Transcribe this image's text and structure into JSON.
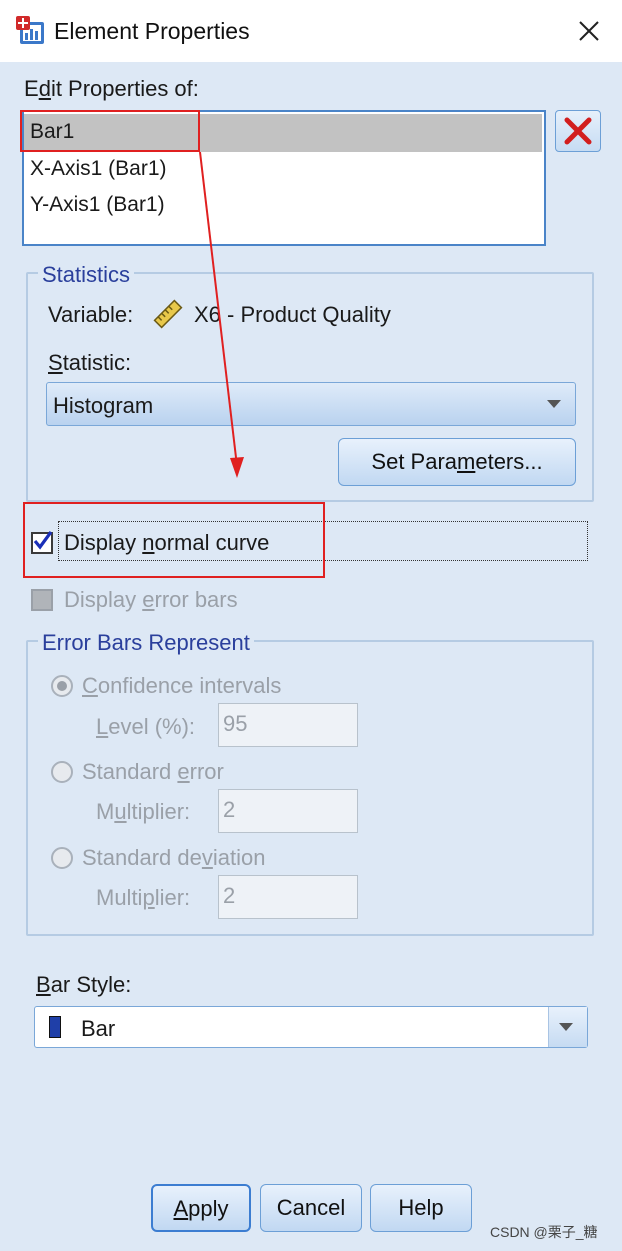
{
  "window": {
    "title": "Element Properties"
  },
  "edit_properties": {
    "label_pre": "E",
    "label_accel": "d",
    "label_post": "it Properties of:",
    "items": [
      "Bar1",
      "X-Axis1 (Bar1)",
      "Y-Axis1 (Bar1)"
    ],
    "selected": "Bar1"
  },
  "statistics": {
    "title": "Statistics",
    "variable_label": "Variable:",
    "variable_value": "X6 - Product Quality",
    "statistic_label_accel": "S",
    "statistic_label_rest": "tatistic:",
    "statistic_value": "Histogram",
    "set_parameters_pre": "Set Para",
    "set_parameters_accel": "m",
    "set_parameters_post": "eters..."
  },
  "display_normal_curve": {
    "pre": "Display ",
    "accel": "n",
    "post": "ormal curve",
    "checked": true
  },
  "display_error_bars": {
    "pre": "Display ",
    "accel": "e",
    "post": "rror bars",
    "checked": false
  },
  "error_bars": {
    "title": "Error Bars Represent",
    "confidence": {
      "accel": "C",
      "rest": "onfidence intervals",
      "selected": true,
      "field_pre": "",
      "field_accel": "L",
      "field_post": "evel (%):",
      "value": "95"
    },
    "std_error": {
      "pre": "Standard ",
      "accel": "e",
      "post": "rror",
      "field_pre": "M",
      "field_accel": "u",
      "field_post": "ltiplier:",
      "value": "2"
    },
    "std_dev": {
      "pre": "Standard de",
      "accel": "v",
      "post": "iation",
      "field_pre": "Multi",
      "field_accel": "p",
      "field_post": "lier:",
      "value": "2"
    }
  },
  "bar_style": {
    "label_accel": "B",
    "label_rest": "ar Style:",
    "value": "Bar",
    "swatch_color": "#1f3fa8"
  },
  "buttons": {
    "apply_accel": "A",
    "apply_rest": "pply",
    "cancel": "Cancel",
    "help": "Help"
  },
  "watermark": "CSDN @栗子_糖"
}
